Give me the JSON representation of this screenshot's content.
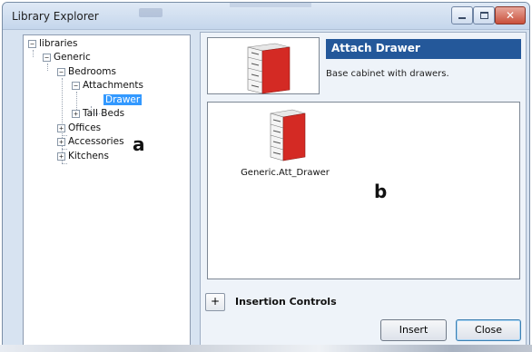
{
  "window": {
    "title": "Library Explorer",
    "controls": {
      "minimize": "minimize",
      "maximize": "maximize",
      "close": "✕"
    }
  },
  "tree": {
    "nodes": [
      {
        "label": "libraries",
        "expander": "−"
      },
      {
        "label": "Generic",
        "expander": "−"
      },
      {
        "label": "Bedrooms",
        "expander": "−"
      },
      {
        "label": "Attachments",
        "expander": "−"
      },
      {
        "label": "Drawer",
        "selected": true
      },
      {
        "label": "Tall Beds",
        "expander": "+"
      },
      {
        "label": "Offices",
        "expander": "+"
      },
      {
        "label": "Accessories",
        "expander": "+"
      },
      {
        "label": "Kitchens",
        "expander": "+"
      }
    ]
  },
  "markers": {
    "a": "a",
    "b": "b"
  },
  "detail": {
    "title": "Attach Drawer",
    "description": "Base cabinet with drawers."
  },
  "items": [
    {
      "label": "Generic.Att_Drawer",
      "icon": "drawer-cabinet-icon"
    }
  ],
  "insertion": {
    "expand_label": "+",
    "label": "Insertion Controls"
  },
  "buttons": {
    "insert": "Insert",
    "close": "Close"
  },
  "colors": {
    "title_bar_accent": "#24589a",
    "selection": "#3399ff",
    "cabinet_red": "#d42a24"
  }
}
